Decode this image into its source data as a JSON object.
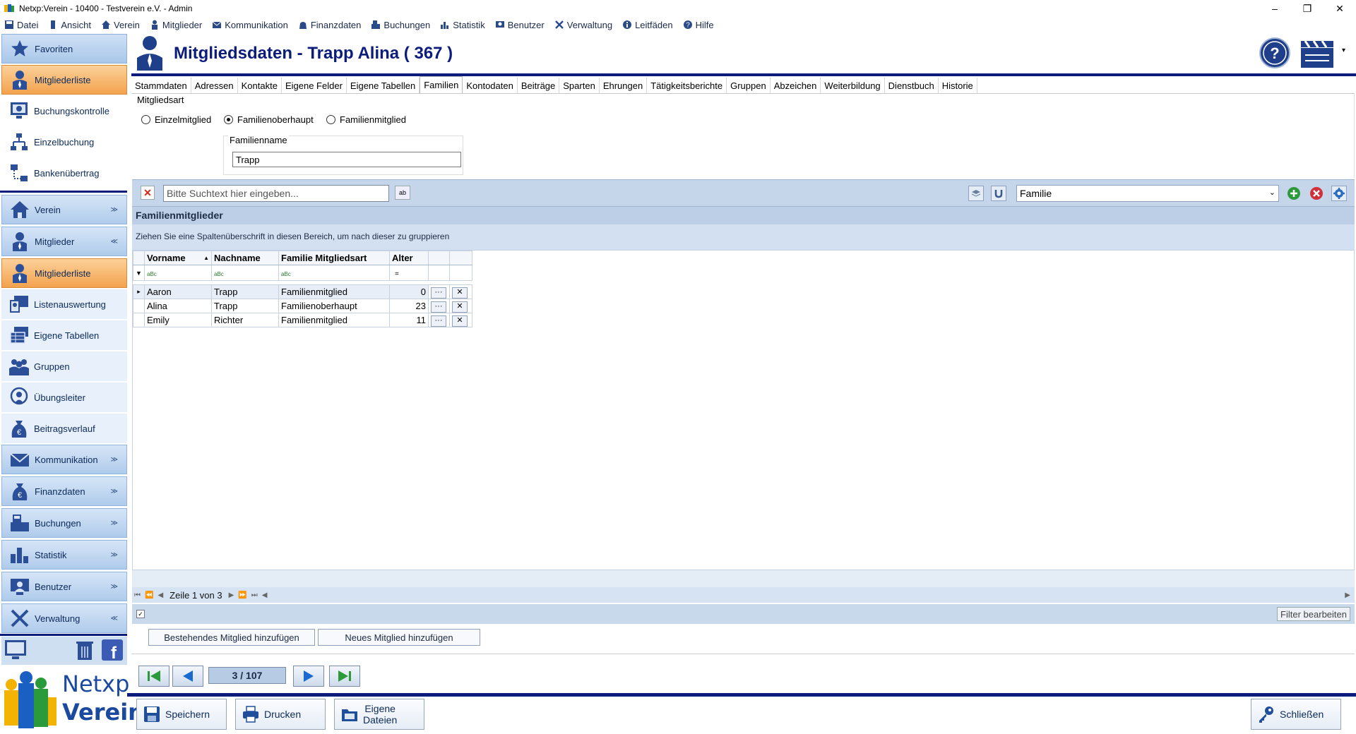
{
  "window": {
    "title": "Netxp:Verein - 10400 - Testverein e.V. - Admin",
    "minimize": "–",
    "restore": "❐",
    "close": "✕"
  },
  "menu": [
    {
      "label": "Datei",
      "icon": "save-icon"
    },
    {
      "label": "Ansicht",
      "icon": "view-icon"
    },
    {
      "label": "Verein",
      "icon": "home-icon"
    },
    {
      "label": "Mitglieder",
      "icon": "person-icon"
    },
    {
      "label": "Kommunikation",
      "icon": "mail-icon"
    },
    {
      "label": "Finanzdaten",
      "icon": "money-icon"
    },
    {
      "label": "Buchungen",
      "icon": "register-icon"
    },
    {
      "label": "Statistik",
      "icon": "chart-icon"
    },
    {
      "label": "Benutzer",
      "icon": "user-icon"
    },
    {
      "label": "Verwaltung",
      "icon": "tools-icon"
    },
    {
      "label": "Leitfäden",
      "icon": "info-icon"
    },
    {
      "label": "Hilfe",
      "icon": "help-icon"
    }
  ],
  "sidebar": {
    "favoriten": "Favoriten",
    "fav_items": [
      "Mitgliederliste",
      "Buchungskontrolle",
      "Einzelbuchung",
      "Bankenübertrag"
    ],
    "verein": "Verein",
    "mitglieder": "Mitglieder",
    "mitglieder_items": [
      "Mitgliederliste",
      "Listenauswertung",
      "Eigene Tabellen",
      "Gruppen",
      "Übungsleiter",
      "Beitragsverlauf"
    ],
    "groups": [
      "Kommunikation",
      "Finanzdaten",
      "Buchungen",
      "Statistik",
      "Benutzer",
      "Verwaltung"
    ],
    "logo_line1": "Netxp",
    "logo_line2": "Verein"
  },
  "header": {
    "title": "Mitgliedsdaten - Trapp Alina ( 367 )",
    "help": "?"
  },
  "tabs": [
    "Stammdaten",
    "Adressen",
    "Kontakte",
    "Eigene Felder",
    "Eigene Tabellen",
    "Familien",
    "Kontodaten",
    "Beiträge",
    "Sparten",
    "Ehrungen",
    "Tätigkeitsberichte",
    "Gruppen",
    "Abzeichen",
    "Weiterbildung",
    "Dienstbuch",
    "Historie"
  ],
  "active_tab": "Familien",
  "mitgliedsart": {
    "label": "Mitgliedsart",
    "options": [
      "Einzelmitglied",
      "Familienoberhaupt",
      "Familienmitglied"
    ],
    "selected": "Familienoberhaupt",
    "familienname_label": "Familienname",
    "familienname_value": "Trapp"
  },
  "toolbar": {
    "search_placeholder": "Bitte Suchtext hier eingeben...",
    "ab": "ab",
    "layout_select": "Familie"
  },
  "grid": {
    "title": "Familienmitglieder",
    "group_hint": "Ziehen Sie eine Spaltenüberschrift in diesen Bereich, um nach dieser zu gruppieren",
    "columns": [
      "Vorname",
      "Nachname",
      "Familie Mitgliedsart",
      "Alter"
    ],
    "filter_icon": "aBc",
    "filter_eq": "=",
    "rows": [
      {
        "vorname": "Aaron",
        "nachname": "Trapp",
        "art": "Familienmitglied",
        "alter": "0"
      },
      {
        "vorname": "Alina",
        "nachname": "Trapp",
        "art": "Familienoberhaupt",
        "alter": "23"
      },
      {
        "vorname": "Emily",
        "nachname": "Richter",
        "art": "Familienmitglied",
        "alter": "11"
      }
    ],
    "row_btn": "···",
    "row_del": "✕",
    "pager": "Zeile 1 von 3",
    "edit_filter": "Filter bearbeiten"
  },
  "buttons": {
    "add_existing": "Bestehendes Mitglied hinzufügen",
    "add_new": "Neues Mitglied hinzufügen"
  },
  "record_nav": {
    "position": "3 / 107"
  },
  "bottom": {
    "save": "Speichern",
    "print": "Drucken",
    "files_line1": "Eigene",
    "files_line2": "Dateien",
    "close": "Schließen"
  },
  "colors": {
    "navy": "#0b1c7c",
    "orange": "#f3a24e",
    "light_blue": "#c5d6ea"
  }
}
